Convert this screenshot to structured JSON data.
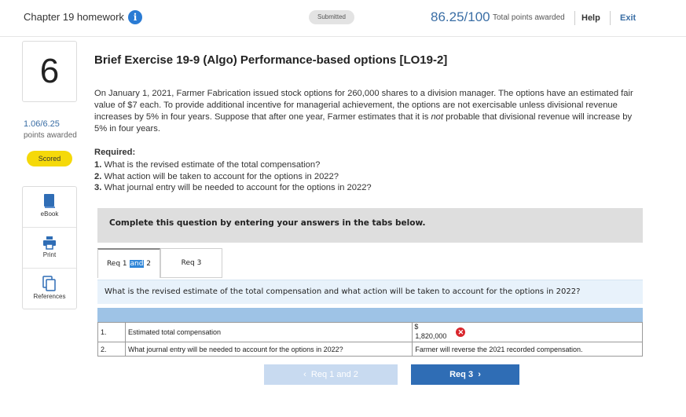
{
  "header": {
    "chapter_title": "Chapter 19 homework",
    "info_icon": "info-icon",
    "status": "Submitted",
    "score": "86.25/100",
    "score_label": "Total points awarded",
    "help": "Help",
    "exit": "Exit"
  },
  "question": {
    "number": "6",
    "points": "1.06/6.25",
    "points_label": "points awarded",
    "scored_badge": "Scored",
    "title": "Brief Exercise 19-9 (Algo) Performance-based options [LO19-2]",
    "prompt_a": "On January 1, 2021, Farmer Fabrication issued stock options for 260,000 shares to a division manager. The options have an estimated fair value of $7 each. To provide additional incentive for managerial achievement, the options are not exercisable unless divisional revenue increases by 5% in four years. Suppose that after one year, Farmer estimates that it is ",
    "prompt_em": "not",
    "prompt_b": " probable that divisional revenue will increase by 5% in four years.",
    "required_label": "Required:",
    "requirements": [
      {
        "num": "1.",
        "text": " What is the revised estimate of the total compensation?"
      },
      {
        "num": "2.",
        "text": " What action will be taken to account for the options in 2022?"
      },
      {
        "num": "3.",
        "text": " What journal entry will be needed to account for the options in 2022?"
      }
    ]
  },
  "tools": [
    {
      "label": "eBook",
      "icon": "book-icon"
    },
    {
      "label": "Print",
      "icon": "printer-icon"
    },
    {
      "label": "References",
      "icon": "references-icon"
    }
  ],
  "instructions": "Complete this question by entering your answers in the tabs below.",
  "tabs": [
    {
      "label_pre": "Req 1 ",
      "label_hl": "and",
      "label_post": " 2",
      "active": true
    },
    {
      "label": "Req 3",
      "active": false
    }
  ],
  "tab_question": "What is the revised estimate of the total compensation and what action will be taken to account for the options in 2022?",
  "answers": [
    {
      "num": "1.",
      "label": "Estimated total compensation",
      "currency": "$",
      "value": "1,820,000",
      "status": "incorrect"
    },
    {
      "num": "2.",
      "label": "What journal entry will be needed to account for the options in 2022?",
      "value": "Farmer will reverse the 2021 recorded compensation."
    }
  ],
  "nav": {
    "prev": "Req 1 and 2",
    "next": "Req 3"
  },
  "colors": {
    "accent": "#2f6db5",
    "error": "#d9262c",
    "scored": "#f5d90a"
  }
}
